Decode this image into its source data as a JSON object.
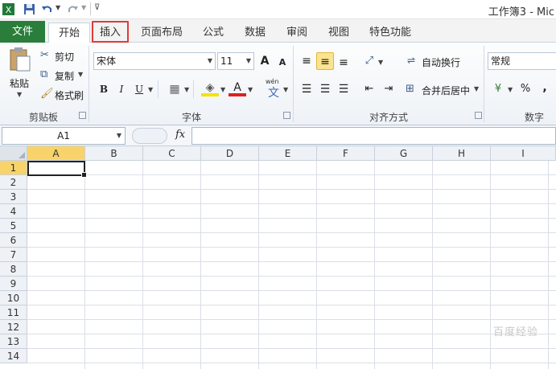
{
  "window": {
    "title": "工作簿3 - Mic"
  },
  "tabs": {
    "file": "文件",
    "items": [
      "开始",
      "插入",
      "页面布局",
      "公式",
      "数据",
      "审阅",
      "视图",
      "特色功能"
    ],
    "active": "开始",
    "highlighted": "插入"
  },
  "ribbon": {
    "clipboard": {
      "paste": "粘贴",
      "cut": "剪切",
      "copy": "复制",
      "format_painter": "格式刷",
      "label": "剪贴板"
    },
    "font": {
      "name": "宋体",
      "size": "11",
      "bold": "B",
      "italic": "I",
      "underline": "U",
      "grow": "A",
      "shrink": "A",
      "wen": "wén",
      "wen_char": "文",
      "label": "字体"
    },
    "alignment": {
      "wrap_text": "自动换行",
      "merge_center": "合并后居中",
      "label": "对齐方式"
    },
    "number": {
      "format": "常规",
      "percent": "%",
      "comma": ",",
      "label": "数字"
    }
  },
  "formula_bar": {
    "name_box": "A1",
    "fx": "fx",
    "value": ""
  },
  "grid": {
    "columns": [
      "A",
      "B",
      "C",
      "D",
      "E",
      "F",
      "G",
      "H",
      "I"
    ],
    "rows": [
      "1",
      "2",
      "3",
      "4",
      "5",
      "6",
      "7",
      "8",
      "9",
      "10",
      "11",
      "12",
      "13",
      "14"
    ],
    "selected_cell": "A1"
  },
  "watermark": "百度经验",
  "colors": {
    "file_tab": "#2a7d3a",
    "highlight_box": "#e03a3a",
    "selected_header": "#f8d36a"
  }
}
